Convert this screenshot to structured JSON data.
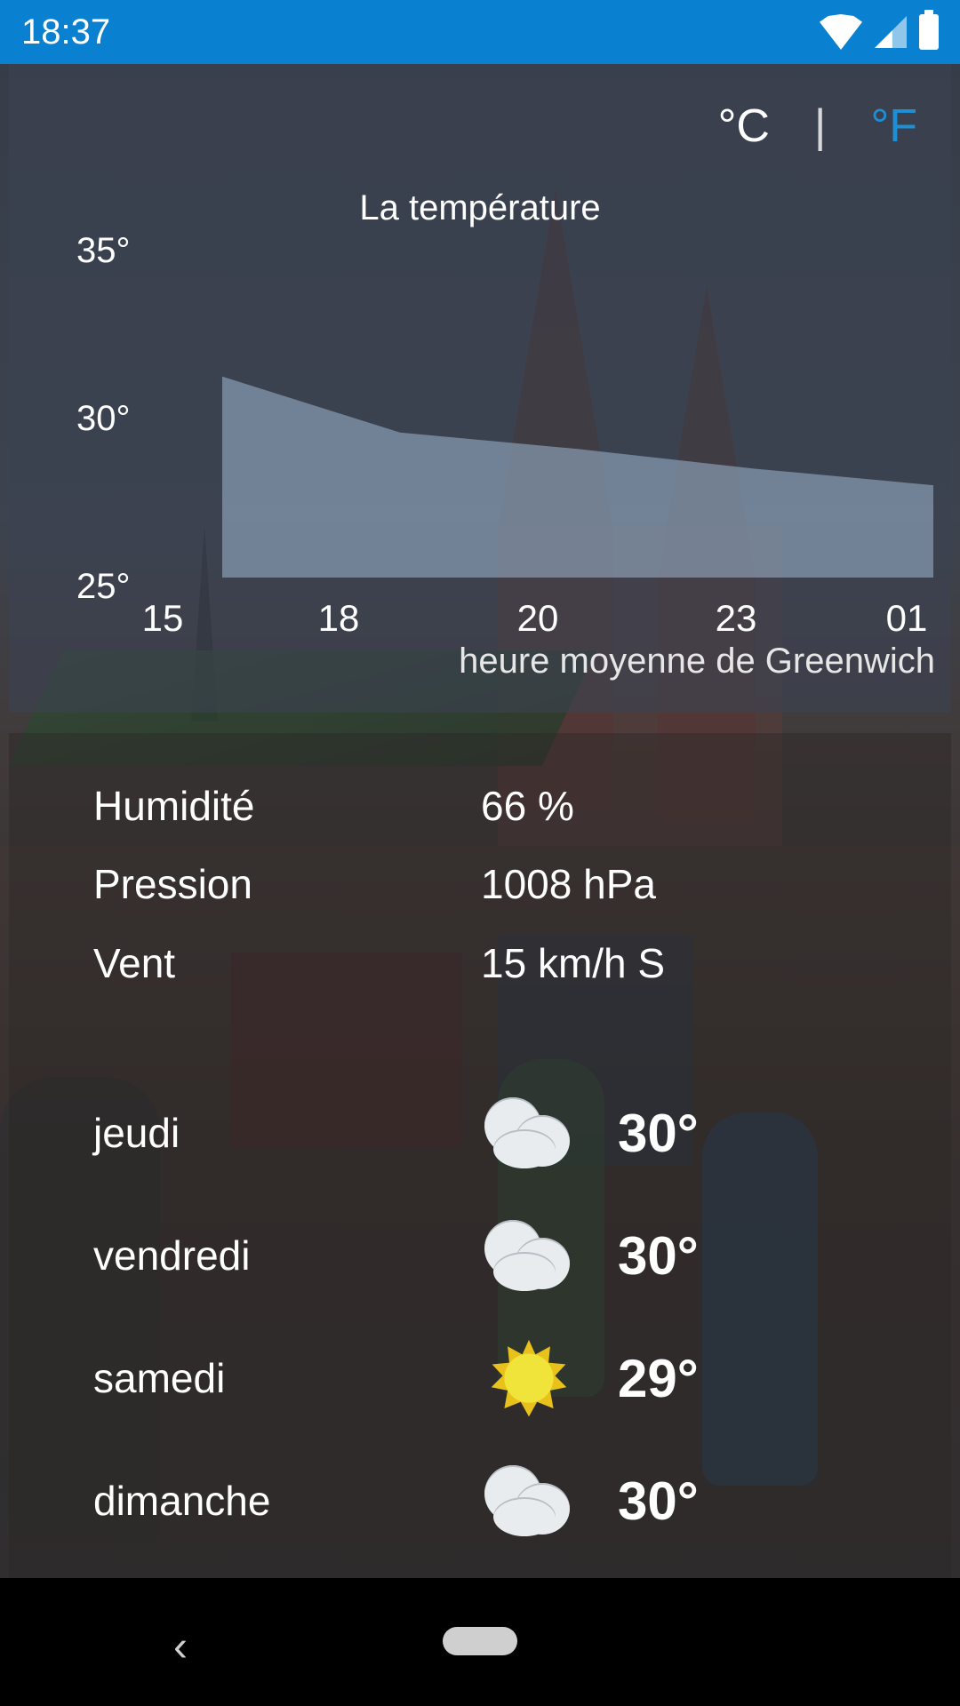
{
  "status_bar": {
    "time": "18:37"
  },
  "units": {
    "celsius": "°C",
    "separator": "|",
    "fahrenheit": "°F",
    "active": "C",
    "inactive_color": "#1e8fd4"
  },
  "chart": {
    "title": "La température",
    "y_ticks": [
      "35°",
      "30°",
      "25°"
    ],
    "x_ticks": [
      "15",
      "18",
      "20",
      "23",
      "01"
    ],
    "x_label": "heure moyenne de Greenwich"
  },
  "chart_data": {
    "type": "area",
    "title": "La température",
    "xlabel": "heure moyenne de Greenwich",
    "ylabel": "",
    "x": [
      "15",
      "18",
      "20",
      "23",
      "01"
    ],
    "series": [
      {
        "values": [
          31.1,
          29.4,
          28.9,
          28.3,
          27.8
        ]
      }
    ],
    "ylim": [
      25,
      35
    ],
    "y_ticks": [
      25,
      30,
      35
    ],
    "grid": false,
    "fill_color": "#9fb8d2"
  },
  "details": [
    {
      "label": "Humidité",
      "value": "66 %"
    },
    {
      "label": "Pression",
      "value": "1008 hPa"
    },
    {
      "label": "Vent",
      "value": "15 km/h S"
    }
  ],
  "forecast": [
    {
      "day": "jeudi",
      "icon": "cloud-icon",
      "temp": "30°"
    },
    {
      "day": "vendredi",
      "icon": "cloud-icon",
      "temp": "30°"
    },
    {
      "day": "samedi",
      "icon": "sun-icon",
      "temp": "29°"
    },
    {
      "day": "dimanche",
      "icon": "cloud-icon",
      "temp": "30°"
    }
  ]
}
